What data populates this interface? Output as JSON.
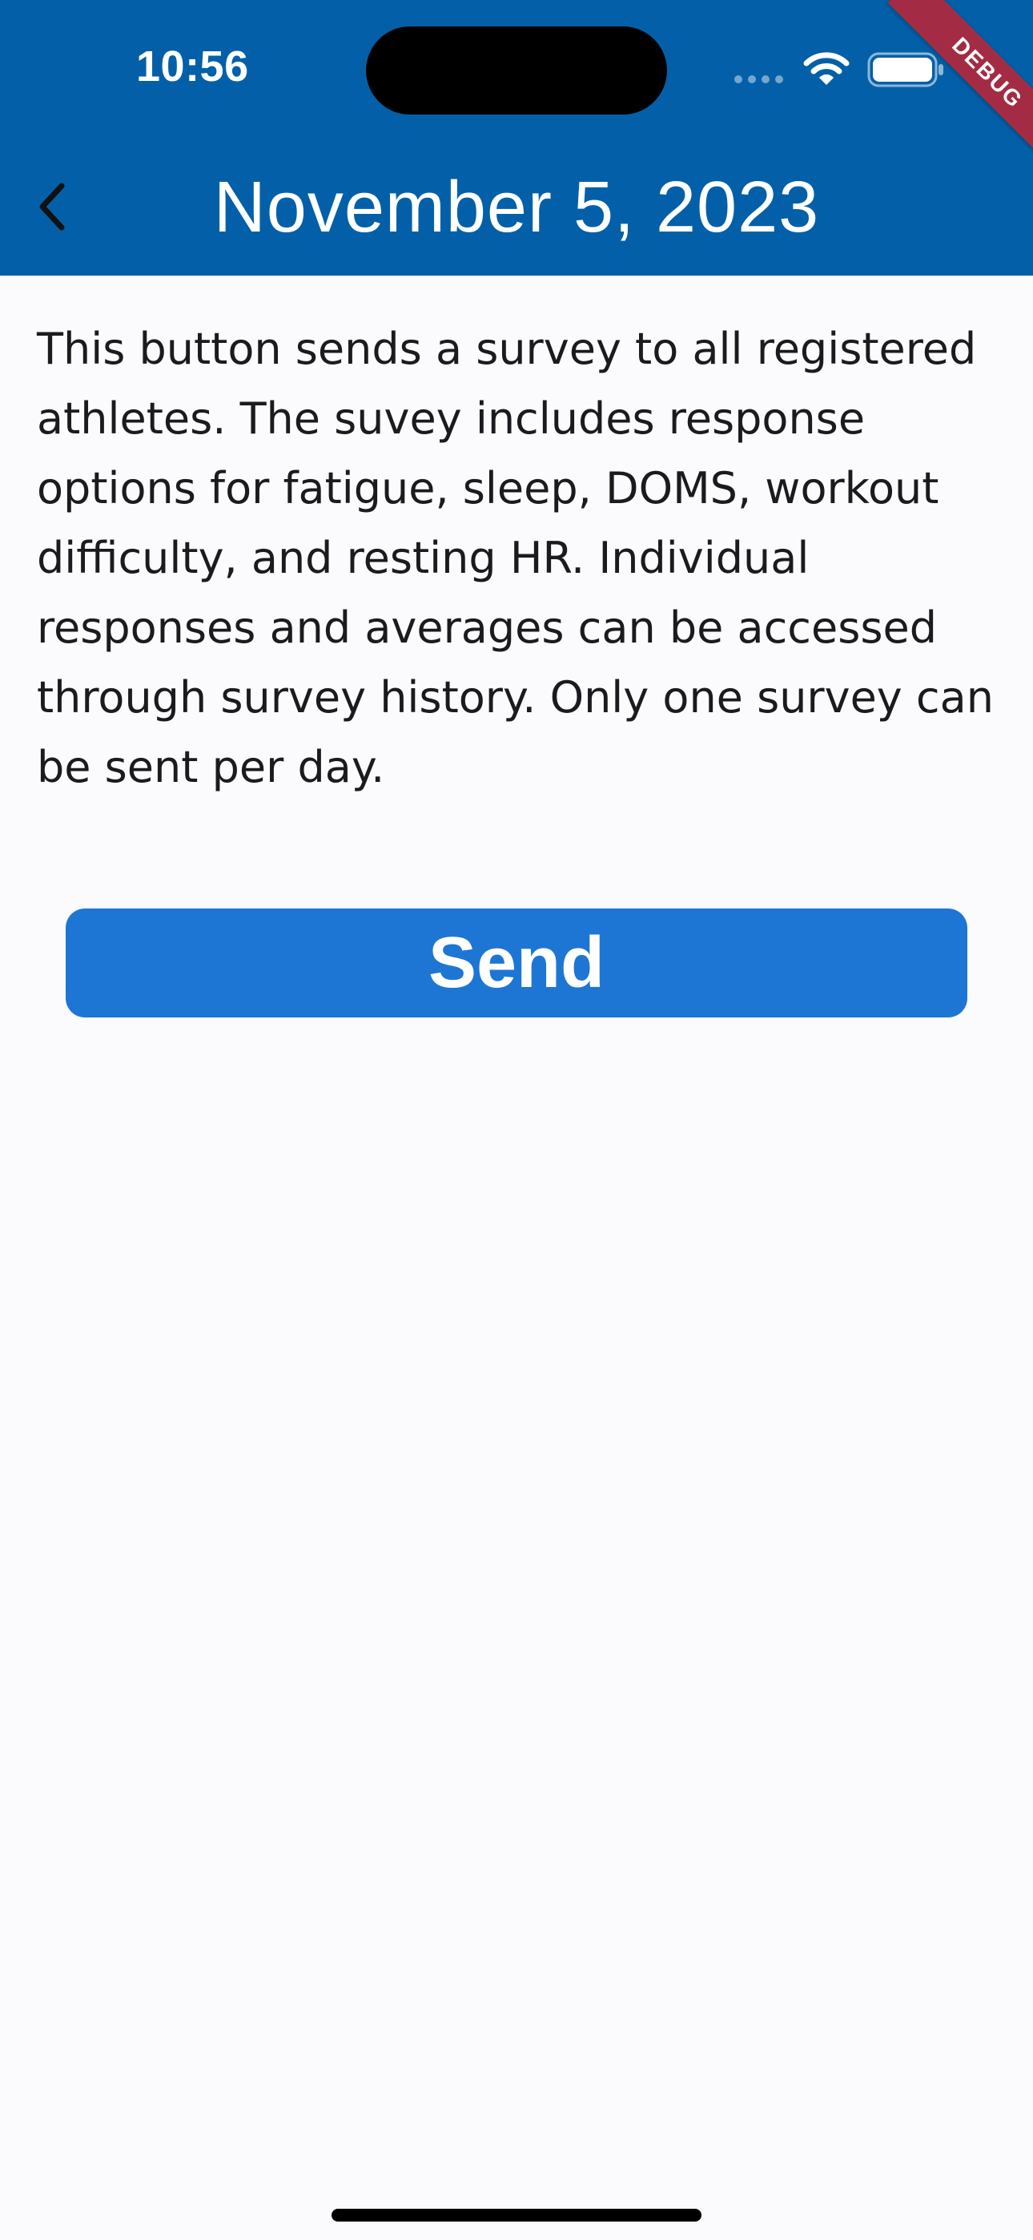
{
  "status_bar": {
    "time": "10:56",
    "icons": [
      "cellular-signal-icon",
      "wifi-icon",
      "battery-icon"
    ]
  },
  "debug_banner": {
    "label": "DEBUG"
  },
  "app_bar": {
    "back_icon": "chevron-left-icon",
    "title": "November 5, 2023"
  },
  "main": {
    "description": "This button sends a survey to all registered athletes. The suvey includes response options for fatigue, sleep, DOMS, workout difficulty, and resting HR. Individual responses and averages can be accessed through survey history. Only one survey can be sent per day.",
    "send_label": "Send"
  },
  "colors": {
    "app_bar": "#0360a8",
    "button": "#1e76d4",
    "background": "#fbfbfe",
    "text": "#1b1b1f",
    "debug_banner": "#a32c44"
  }
}
